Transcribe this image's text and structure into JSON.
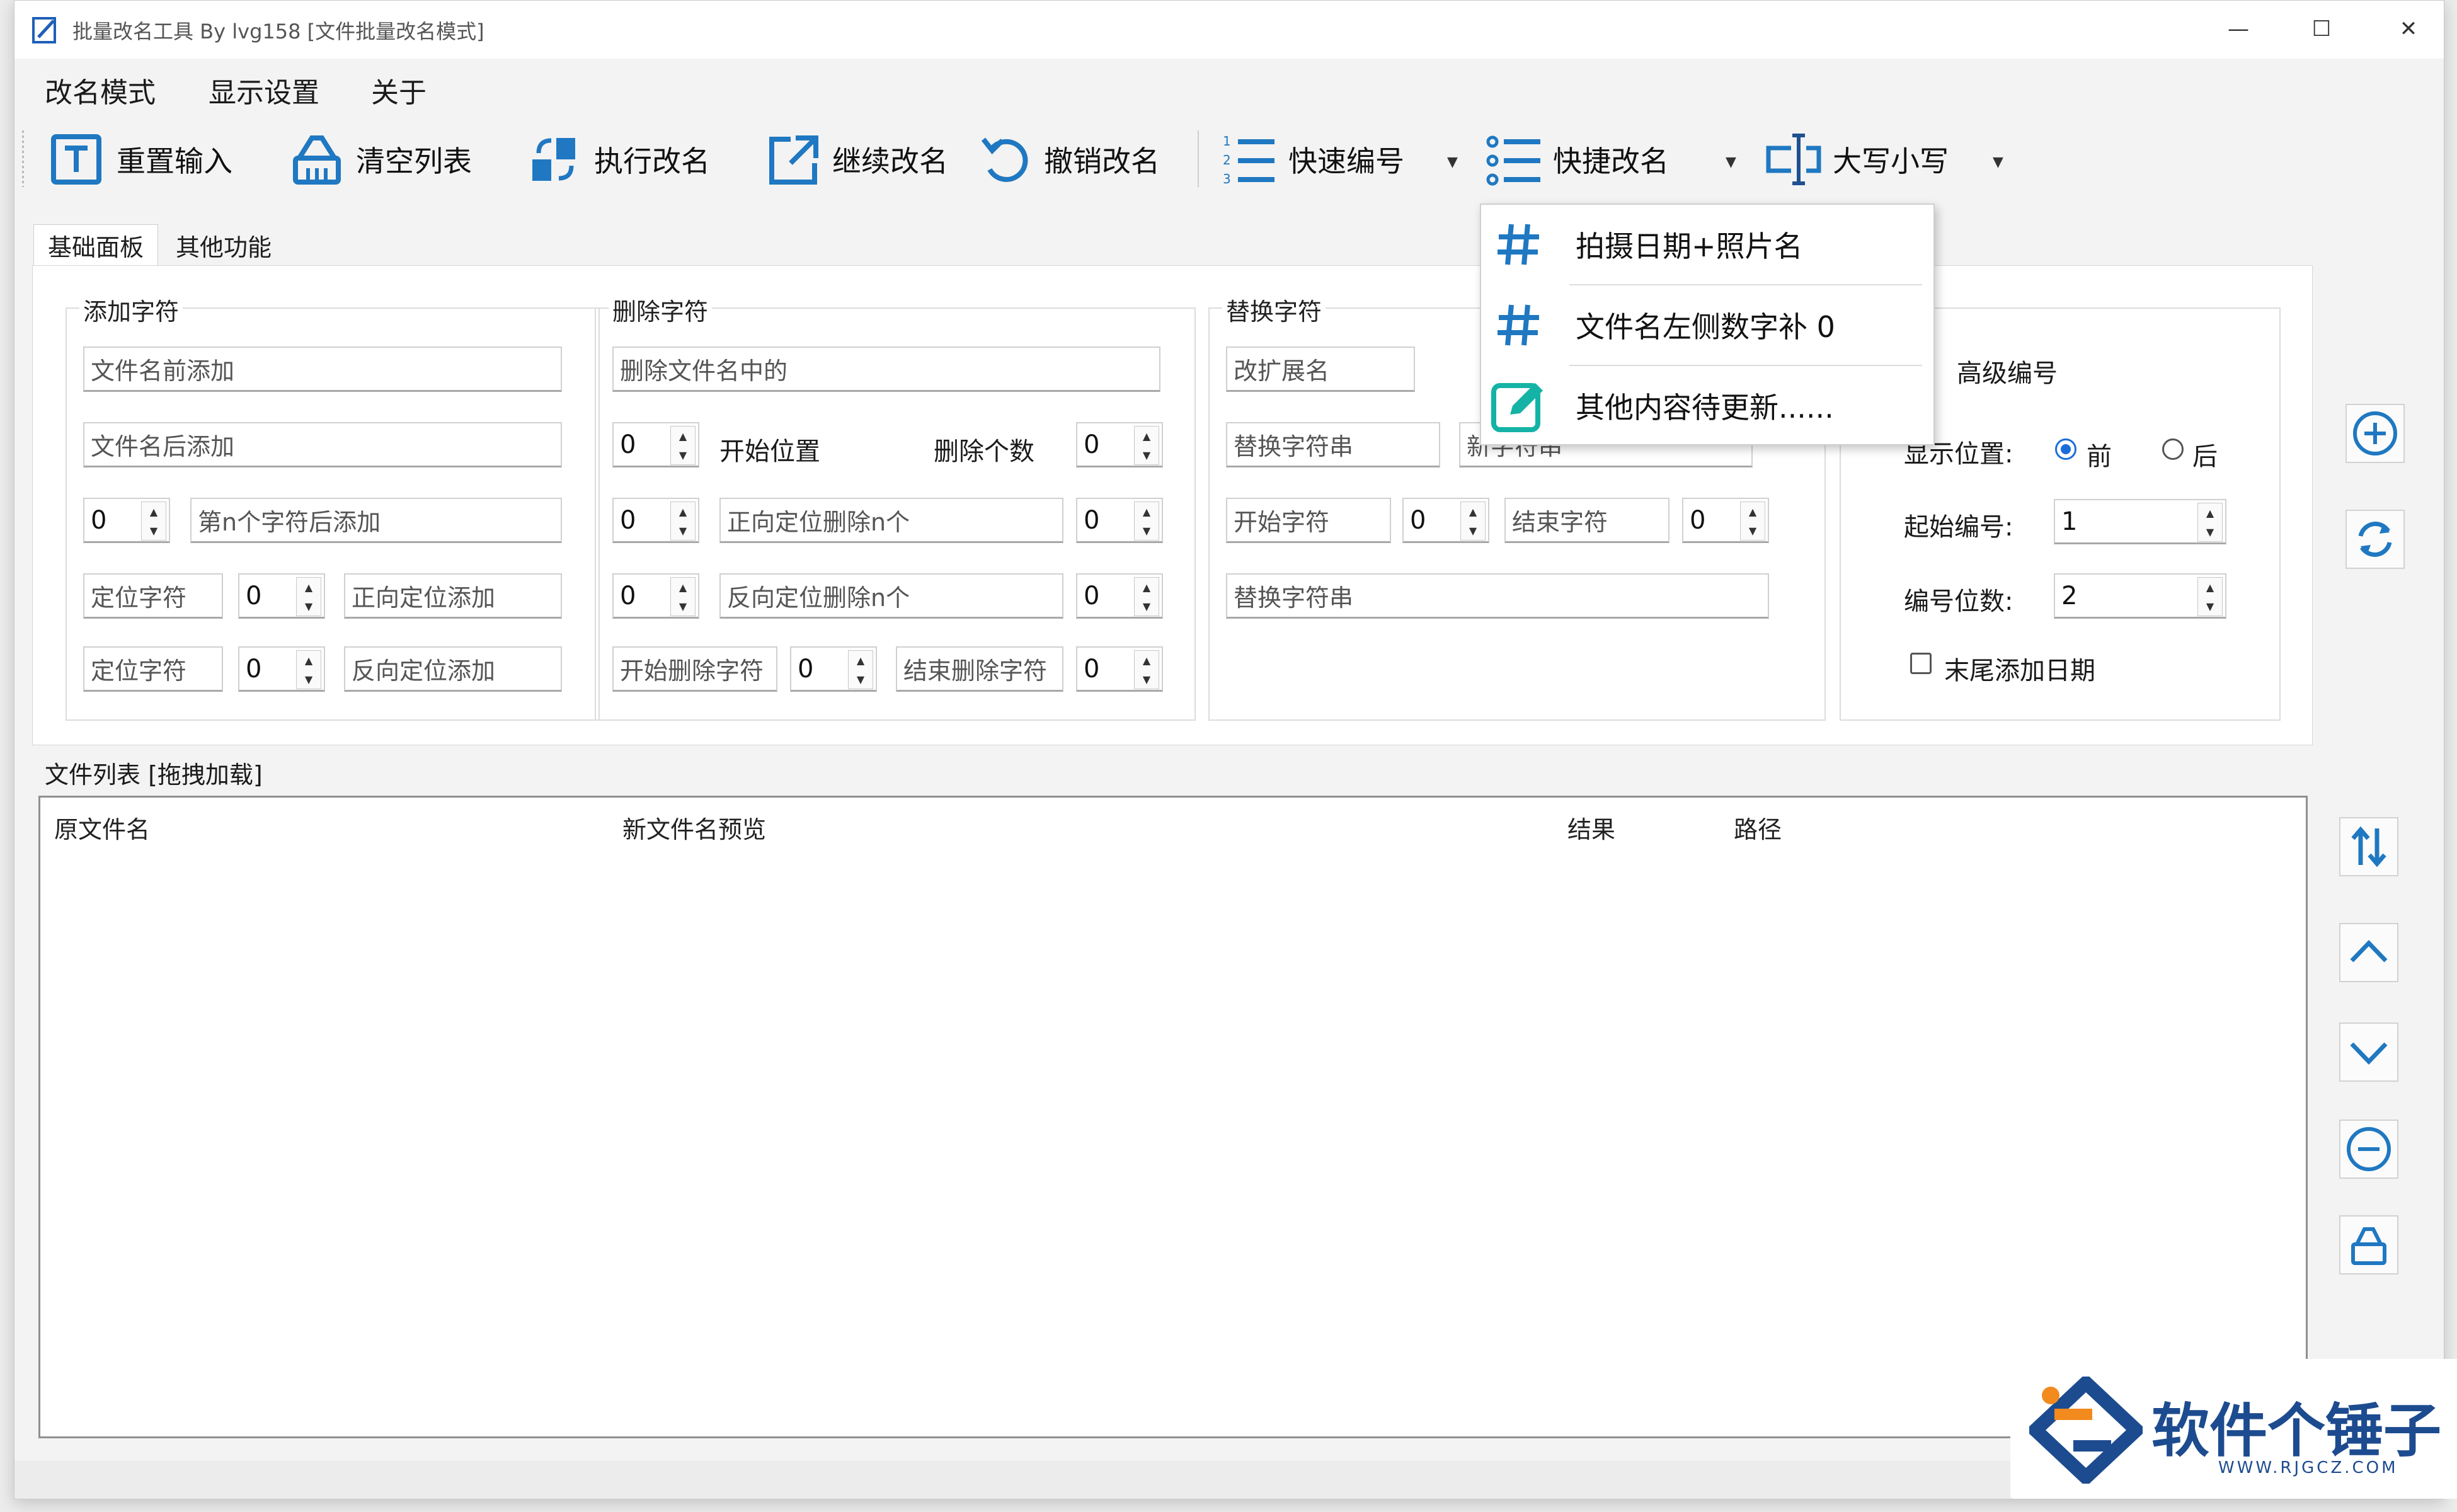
{
  "window": {
    "title": "批量改名工具 By lvg158 [文件批量改名模式]",
    "minimize": "—",
    "maximize": "☐",
    "close": "✕"
  },
  "menu": [
    "改名模式",
    "显示设置",
    "关于"
  ],
  "toolbar": {
    "reset_input": "重置输入",
    "clear_list": "清空列表",
    "execute": "执行改名",
    "continue": "继续改名",
    "undo": "撤销改名",
    "quick_number": "快速编号",
    "quick_rename": "快捷改名",
    "case": "大写小写",
    "accent_color": "#1f78c1"
  },
  "quick_rename_menu": [
    {
      "label": "拍摄日期+照片名",
      "icon": "hash-icon"
    },
    {
      "label": "文件名左侧数字补 0",
      "icon": "hash-icon"
    },
    {
      "label": "其他内容待更新......",
      "icon": "edit-icon"
    }
  ],
  "tabs": [
    "基础面板",
    "其他功能"
  ],
  "add_group": {
    "title": "添加字符",
    "prefix_placeholder": "文件名前添加",
    "suffix_placeholder": "文件名后添加",
    "nth_value": "0",
    "nth_placeholder": "第n个字符后添加",
    "locate1_placeholder": "定位字符",
    "locate1_value": "0",
    "forward_add": "正向定位添加",
    "locate2_placeholder": "定位字符",
    "locate2_value": "0",
    "reverse_add": "反向定位添加"
  },
  "delete_group": {
    "title": "删除字符",
    "in_name_placeholder": "删除文件名中的",
    "start_value": "0",
    "start_label": "开始位置",
    "count_label": "删除个数",
    "count_value": "0",
    "forward_value1": "0",
    "forward_label": "正向定位删除n个",
    "forward_value2": "0",
    "reverse_value1": "0",
    "reverse_label": "反向定位删除n个",
    "reverse_value2": "0",
    "start_char_placeholder": "开始删除字符",
    "start_char_value": "0",
    "end_char_placeholder": "结束删除字符",
    "end_char_value": "0"
  },
  "replace_group": {
    "title": "替换字符",
    "ext_placeholder": "改扩展名",
    "replace_str_placeholder": "替换字符串",
    "new_str_placeholder": "新字符串",
    "start_char": "开始字符",
    "start_value": "0",
    "end_char": "结束字符",
    "end_value": "0",
    "replace_between_placeholder": "替换字符串"
  },
  "number_group": {
    "title": "高级编号",
    "position_label": "显示位置:",
    "front": "前",
    "back": "后",
    "start_label": "起始编号:",
    "start_value": "1",
    "digits_label": "编号位数:",
    "digits_value": "2",
    "add_date": "末尾添加日期"
  },
  "file_list": {
    "title": "文件列表 [拖拽加载]",
    "columns": [
      "原文件名",
      "新文件名预览",
      "结果",
      "路径"
    ],
    "rows": []
  },
  "watermark": {
    "text": "软件个锤子",
    "url": "WWW.RJGCZ.COM"
  }
}
